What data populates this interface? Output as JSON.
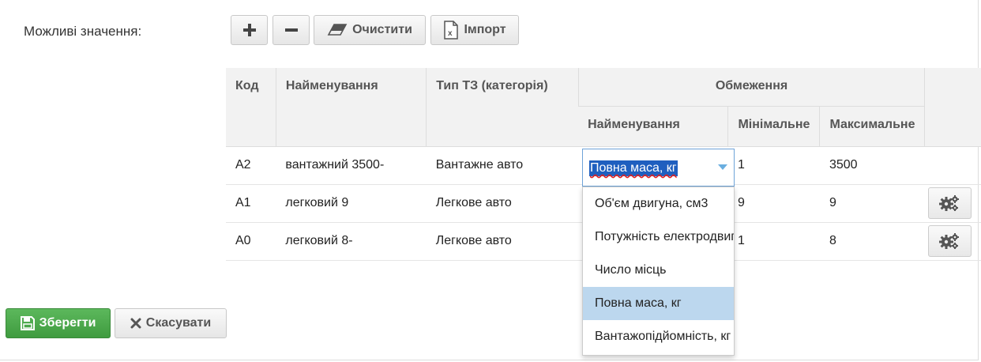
{
  "form": {
    "label": "Можливі значення:"
  },
  "toolbar": {
    "add_icon": "plus-icon",
    "remove_icon": "minus-icon",
    "clear_label": "Очистити",
    "clear_icon": "eraser-icon",
    "import_label": "Імпорт",
    "import_icon": "excel-file-icon"
  },
  "table": {
    "headers": {
      "code": "Код",
      "name": "Найменування",
      "vehicle_type": "Тип ТЗ (категорія)",
      "limits": "Обмеження",
      "limit_name": "Найменування",
      "limit_min": "Мінімальне",
      "limit_max": "Максимальне"
    },
    "rows": [
      {
        "code": "A2",
        "name": "вантажний 3500-",
        "vehicle_type": "Вантажне авто",
        "limit_name": "Повна маса, кг",
        "min": "1",
        "max": "3500"
      },
      {
        "code": "A1",
        "name": "легковий 9",
        "vehicle_type": "Легкове авто",
        "limit_name": "",
        "min": "9",
        "max": "9"
      },
      {
        "code": "A0",
        "name": "легковий 8-",
        "vehicle_type": "Легкове авто",
        "limit_name": "",
        "min": "1",
        "max": "8"
      }
    ]
  },
  "limit_select": {
    "selected": "Повна маса, кг",
    "options": [
      "Об'єм двигуна, см3",
      "Потужність електродвигуна",
      "Число місць",
      "Повна маса, кг",
      "Вантажопідйомність, кг"
    ],
    "highlighted_index": 3
  },
  "footer": {
    "save_label": "Зберегти",
    "save_icon": "floppy-disk-icon",
    "cancel_label": "Скасувати",
    "cancel_icon": "close-icon"
  },
  "colors": {
    "save_green": "#4cae4c",
    "select_highlight": "#1f5fbf",
    "option_selected_bg": "#bcd7ee"
  }
}
